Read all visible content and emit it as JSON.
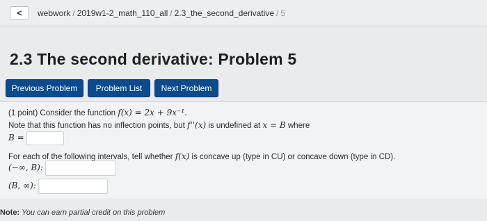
{
  "breadcrumb": {
    "back_glyph": "<",
    "items": [
      "webwork",
      "2019w1-2_math_110_all",
      "2.3_the_second_derivative"
    ],
    "current": "5"
  },
  "page_title": "2.3 The second derivative: Problem 5",
  "nav": {
    "previous": "Previous Problem",
    "list": "Problem List",
    "next": "Next Problem"
  },
  "problem": {
    "points": "(1 point)",
    "intro": "Consider the function",
    "function_expr": "f(x) = 2x + 9x⁻¹.",
    "note_text_a": "Note that this function has no inflection points, but",
    "note_expr": "f''(x)",
    "note_text_b": "is undefined at",
    "note_x_eq_b": "x = B",
    "note_text_c": "where",
    "b_label": "B =",
    "b_value": "",
    "concavity_prompt_a": "For each of the following intervals, tell whether",
    "concavity_fx": "f(x)",
    "concavity_prompt_b": "is concave up (type in CU) or concave down (type in CD).",
    "intervals": [
      {
        "label": "(−∞, B):",
        "value": ""
      },
      {
        "label": "(B, ∞):",
        "value": ""
      }
    ]
  },
  "footer_note": {
    "bold": "Note:",
    "italic": "You can earn partial credit on this problem"
  }
}
